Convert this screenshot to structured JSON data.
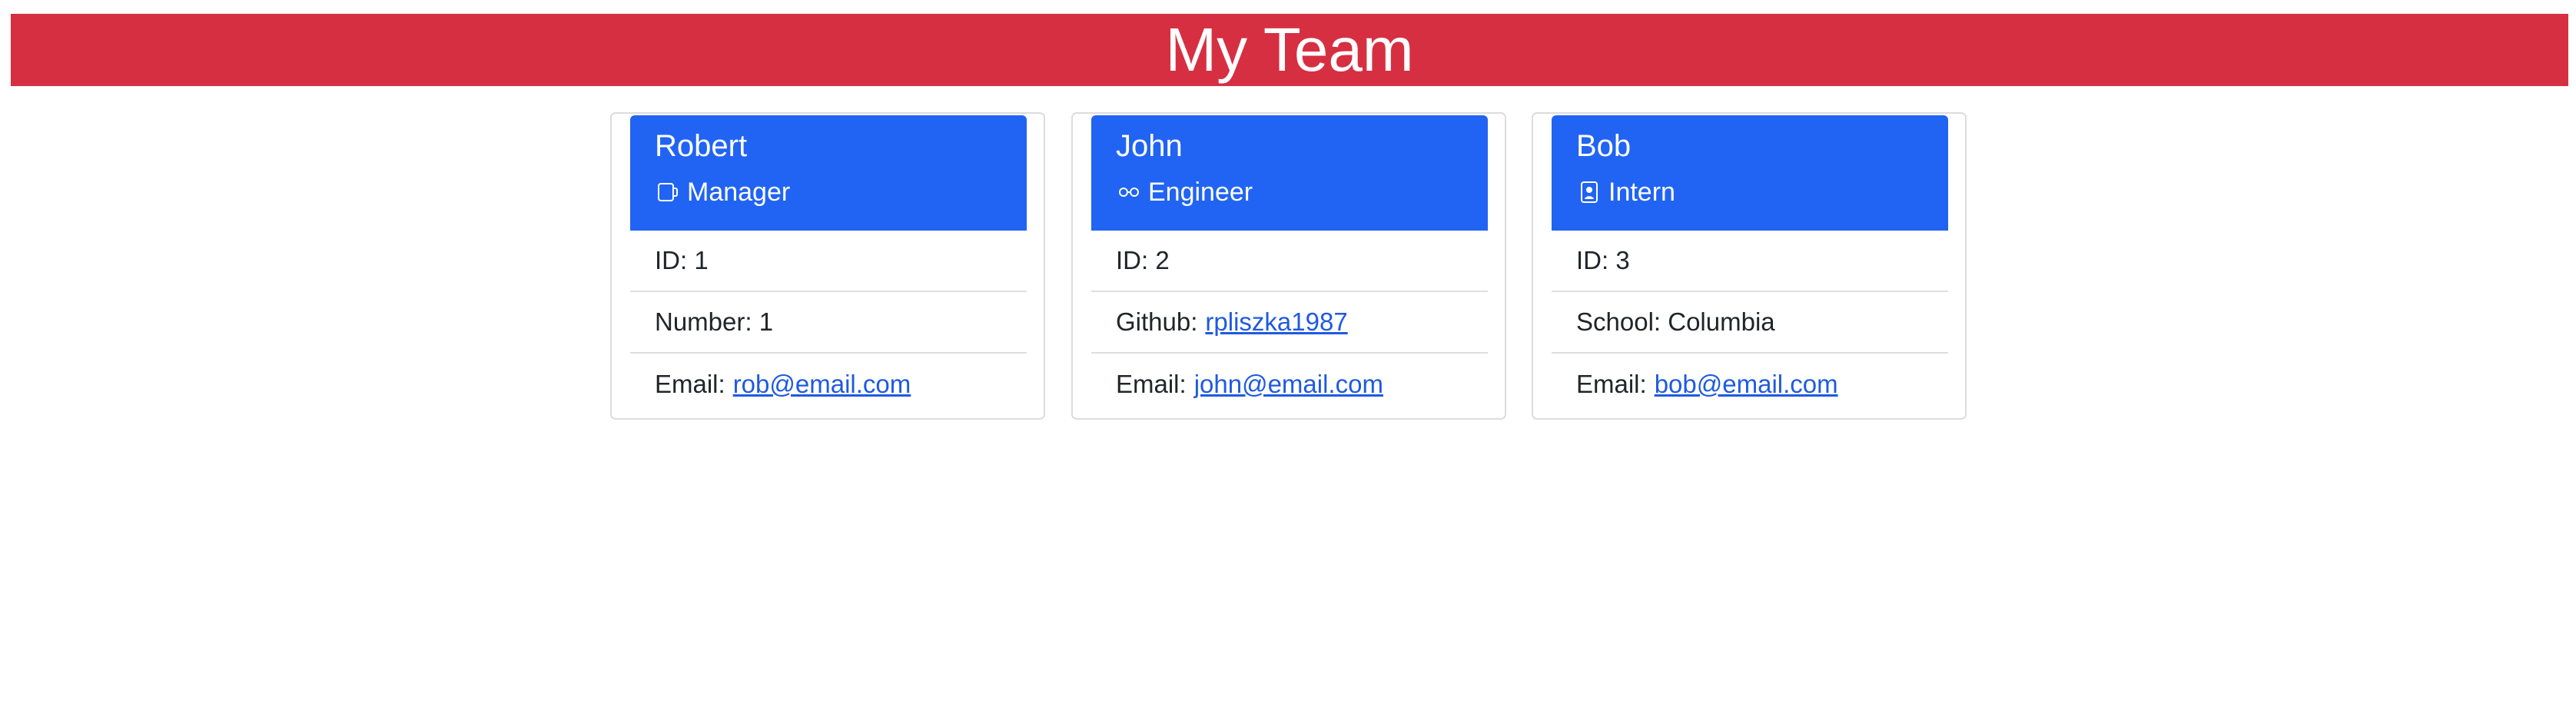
{
  "page": {
    "title": "My Team",
    "colors": {
      "header": "#d72f42",
      "card_header": "#2164f3",
      "link": "#1f5ae0"
    }
  },
  "members": [
    {
      "name": "Robert",
      "role": "Manager",
      "icon": "coffee-mug-icon",
      "rows": [
        {
          "label": "ID: 1",
          "link": ""
        },
        {
          "label": "Number: 1",
          "link": ""
        },
        {
          "label": "Email:",
          "link": "rob@email.com"
        }
      ]
    },
    {
      "name": "John",
      "role": "Engineer",
      "icon": "glasses-icon",
      "rows": [
        {
          "label": "ID: 2",
          "link": ""
        },
        {
          "label": "Github:",
          "link": "rpliszka1987"
        },
        {
          "label": "Email:",
          "link": "john@email.com"
        }
      ]
    },
    {
      "name": "Bob",
      "role": "Intern",
      "icon": "person-badge-icon",
      "rows": [
        {
          "label": "ID: 3",
          "link": ""
        },
        {
          "label": "School: Columbia",
          "link": ""
        },
        {
          "label": "Email:",
          "link": "bob@email.com"
        }
      ]
    }
  ]
}
